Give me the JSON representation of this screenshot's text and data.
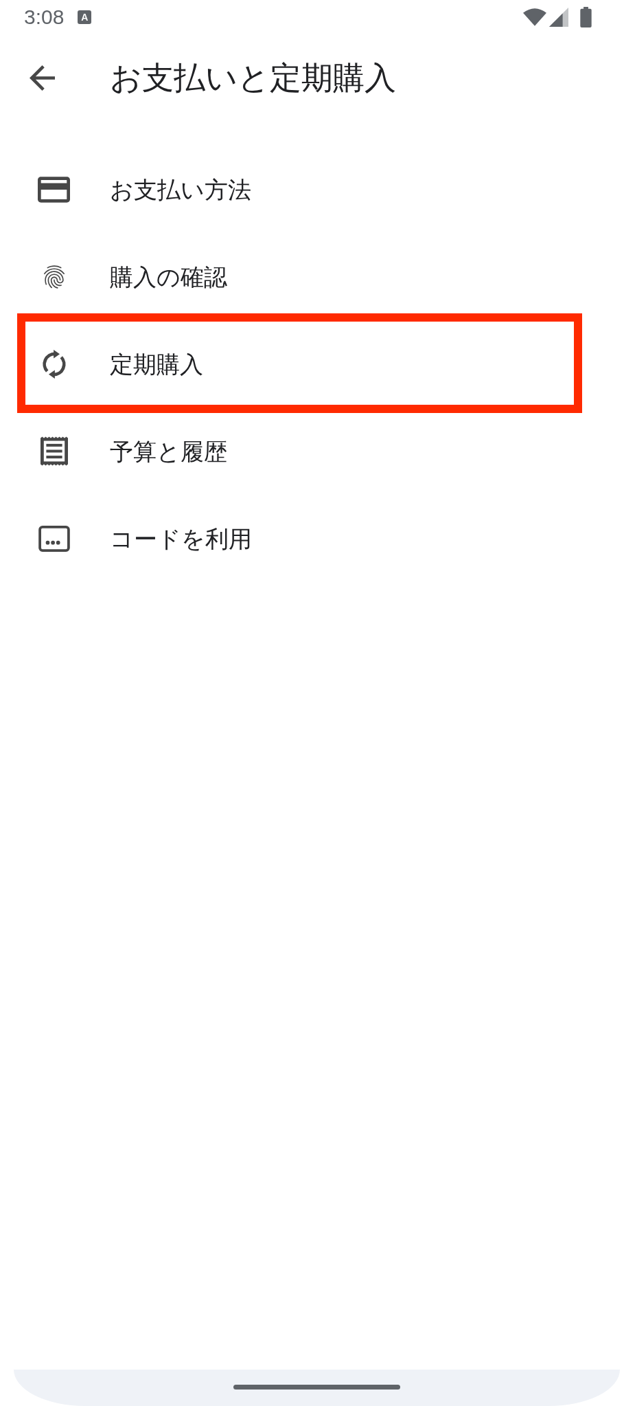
{
  "status_bar": {
    "time": "3:08",
    "notification_glyph": "A"
  },
  "header": {
    "title": "お支払いと定期購入"
  },
  "items": [
    {
      "label": "お支払い方法",
      "highlighted": false
    },
    {
      "label": "購入の確認",
      "highlighted": false
    },
    {
      "label": "定期購入",
      "highlighted": true
    },
    {
      "label": "予算と履歴",
      "highlighted": false
    },
    {
      "label": "コードを利用",
      "highlighted": false
    }
  ]
}
